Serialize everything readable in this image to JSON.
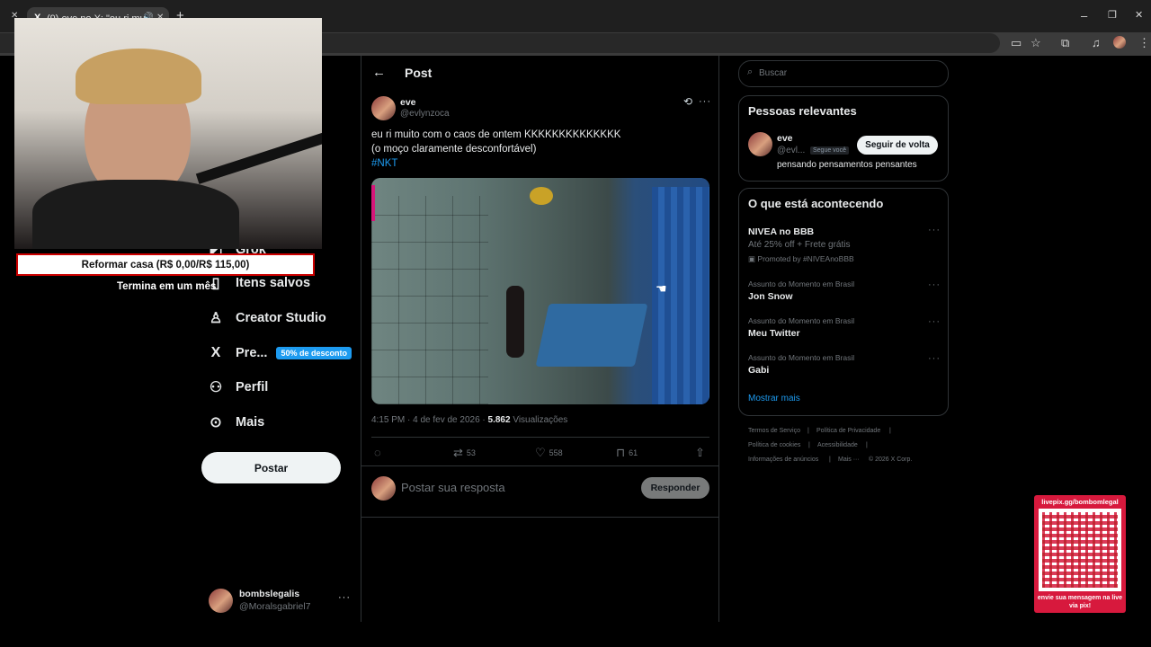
{
  "browser": {
    "tab_title": "(9) eve no X: \"eu ri muito c",
    "window_controls": {
      "minimize": "–",
      "restore": "❐",
      "close": "✕"
    }
  },
  "nav": {
    "items": [
      {
        "label": "Grok",
        "icon": "grok-icon"
      },
      {
        "label": "Itens salvos",
        "icon": "bookmark-icon"
      },
      {
        "label": "Creator Studio",
        "icon": "creator-studio-icon"
      },
      {
        "label": "Pre...",
        "icon": "x-logo-icon",
        "badge": "50% de desconto"
      },
      {
        "label": "Perfil",
        "icon": "person-icon"
      },
      {
        "label": "Mais",
        "icon": "more-circle-icon"
      }
    ],
    "post_button": "Postar",
    "account": {
      "name": "bombslegalis",
      "handle": "@Moralsgabriel7"
    }
  },
  "overlay": {
    "goal_text": "Reformar casa (R$ 0,00/R$ 115,00)",
    "goal_sub": "Termina em um mês",
    "qr_top": "livepix.gg/bombomlegal",
    "qr_bottom": "envie sua mensagem na live via pix!"
  },
  "post": {
    "header": "Post",
    "author_name": "eve",
    "author_handle": "@evlynzoca",
    "text_line1": "eu ri muito com o caos de ontem KKKKKKKKKKKKKK",
    "text_line2": "(o moço claramente desconfortável)",
    "hashtag": "#NKT",
    "timestamp": "4:15 PM · 4 de fev de 2026 · ",
    "views_count": "5.862",
    "views_label": " Visualizações",
    "retweets": "53",
    "likes": "558",
    "bookmarks": "61",
    "reply_placeholder": "Postar sua resposta",
    "reply_button": "Responder"
  },
  "sidebar": {
    "search_placeholder": "Buscar",
    "relevant_title": "Pessoas relevantes",
    "relevant_person": {
      "name": "eve",
      "handle": "@evl...",
      "follows_you": "Segue você",
      "follow_button": "Seguir de volta",
      "bio": "pensando pensamentos pensantes"
    },
    "trends_title": "O que está acontecendo",
    "promoted": {
      "title": "NIVEA no BBB",
      "subtitle": "Até 25% off + Frete grátis",
      "promoted_by": "Promoted by #NIVEAnoBBB"
    },
    "trends": [
      {
        "context": "Assunto do Momento em Brasil",
        "name": "Jon Snow"
      },
      {
        "context": "Assunto do Momento em Brasil",
        "name": "Meu Twitter"
      },
      {
        "context": "Assunto do Momento em Brasil",
        "name": "Gabi"
      }
    ],
    "show_more": "Mostrar mais",
    "footer": {
      "terms": "Termos de Serviço",
      "privacy": "Política de Privacidade",
      "cookies": "Política de cookies",
      "accessibility": "Acessibilidade",
      "ads": "Informações de anúncios",
      "more": "Mais ···",
      "copyright": "© 2026 X Corp."
    }
  },
  "colors": {
    "accent": "#1d9bf0",
    "background": "#000000",
    "border": "#2f3336",
    "muted": "#71767b",
    "qr_frame": "#d7193d"
  }
}
